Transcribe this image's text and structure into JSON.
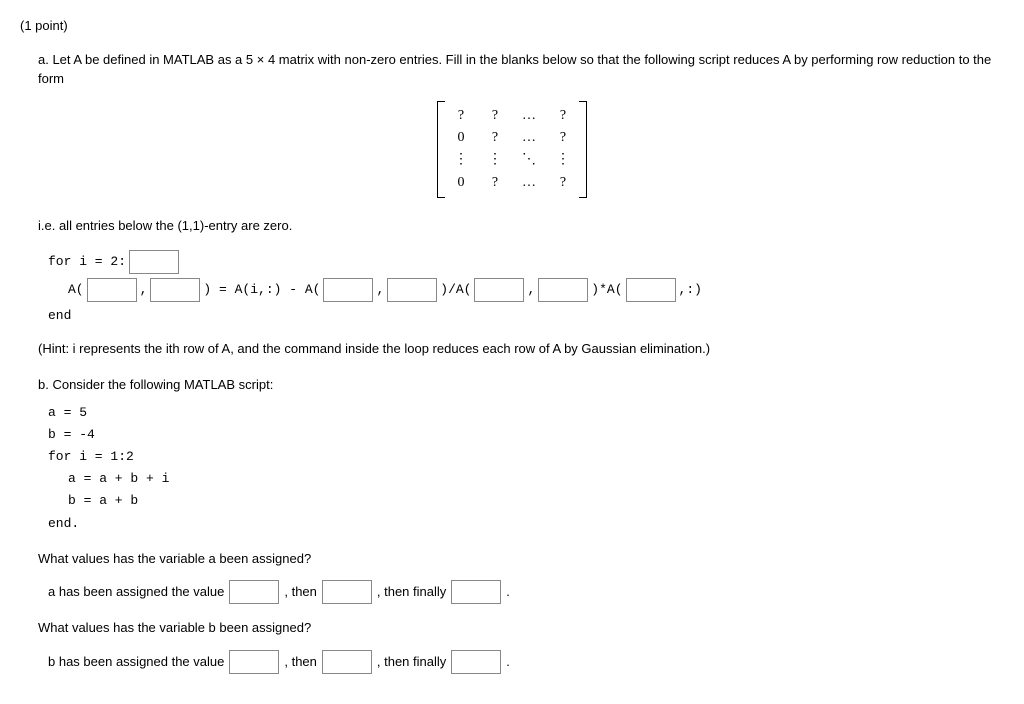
{
  "points": "(1 point)",
  "partA": {
    "intro": "a. Let A be defined in MATLAB as a 5 × 4 matrix with non-zero entries. Fill in the blanks below so that the following script reduces A by performing row reduction to the form",
    "matrix": [
      [
        "?",
        "?",
        "…",
        "?"
      ],
      [
        "0",
        "?",
        "…",
        "?"
      ],
      [
        "⋮",
        "⋮",
        "⋱",
        "⋮"
      ],
      [
        "0",
        "?",
        "…",
        "?"
      ]
    ],
    "subnote": "i.e. all entries below the (1,1)-entry are zero.",
    "code": {
      "for_prefix": "for i = 2:",
      "A_open": "A(",
      "comma": " , ",
      "close_eq": ") = A(i,:) - A(",
      "slashA": ")/A(",
      "starA": ")*A(",
      "tail": ",:)",
      "end": "end"
    },
    "hint": "(Hint: i represents the ith row of A, and the command inside the loop reduces each row of A by Gaussian elimination.)"
  },
  "partB": {
    "intro": "b. Consider the following MATLAB script:",
    "code": {
      "l1": "a = 5",
      "l2": "b = -4",
      "l3": "for i = 1:2",
      "l4": "a = a + b + i",
      "l5": "b = a + b",
      "l6": "end."
    },
    "qA": "What values has the variable a been assigned?",
    "ansA_prefix": "a has been assigned the value",
    "then": ", then",
    "then_finally": ", then finally",
    "period": ".",
    "qB": "What values has the variable b been assigned?",
    "ansB_prefix": "b has been assigned the value"
  }
}
